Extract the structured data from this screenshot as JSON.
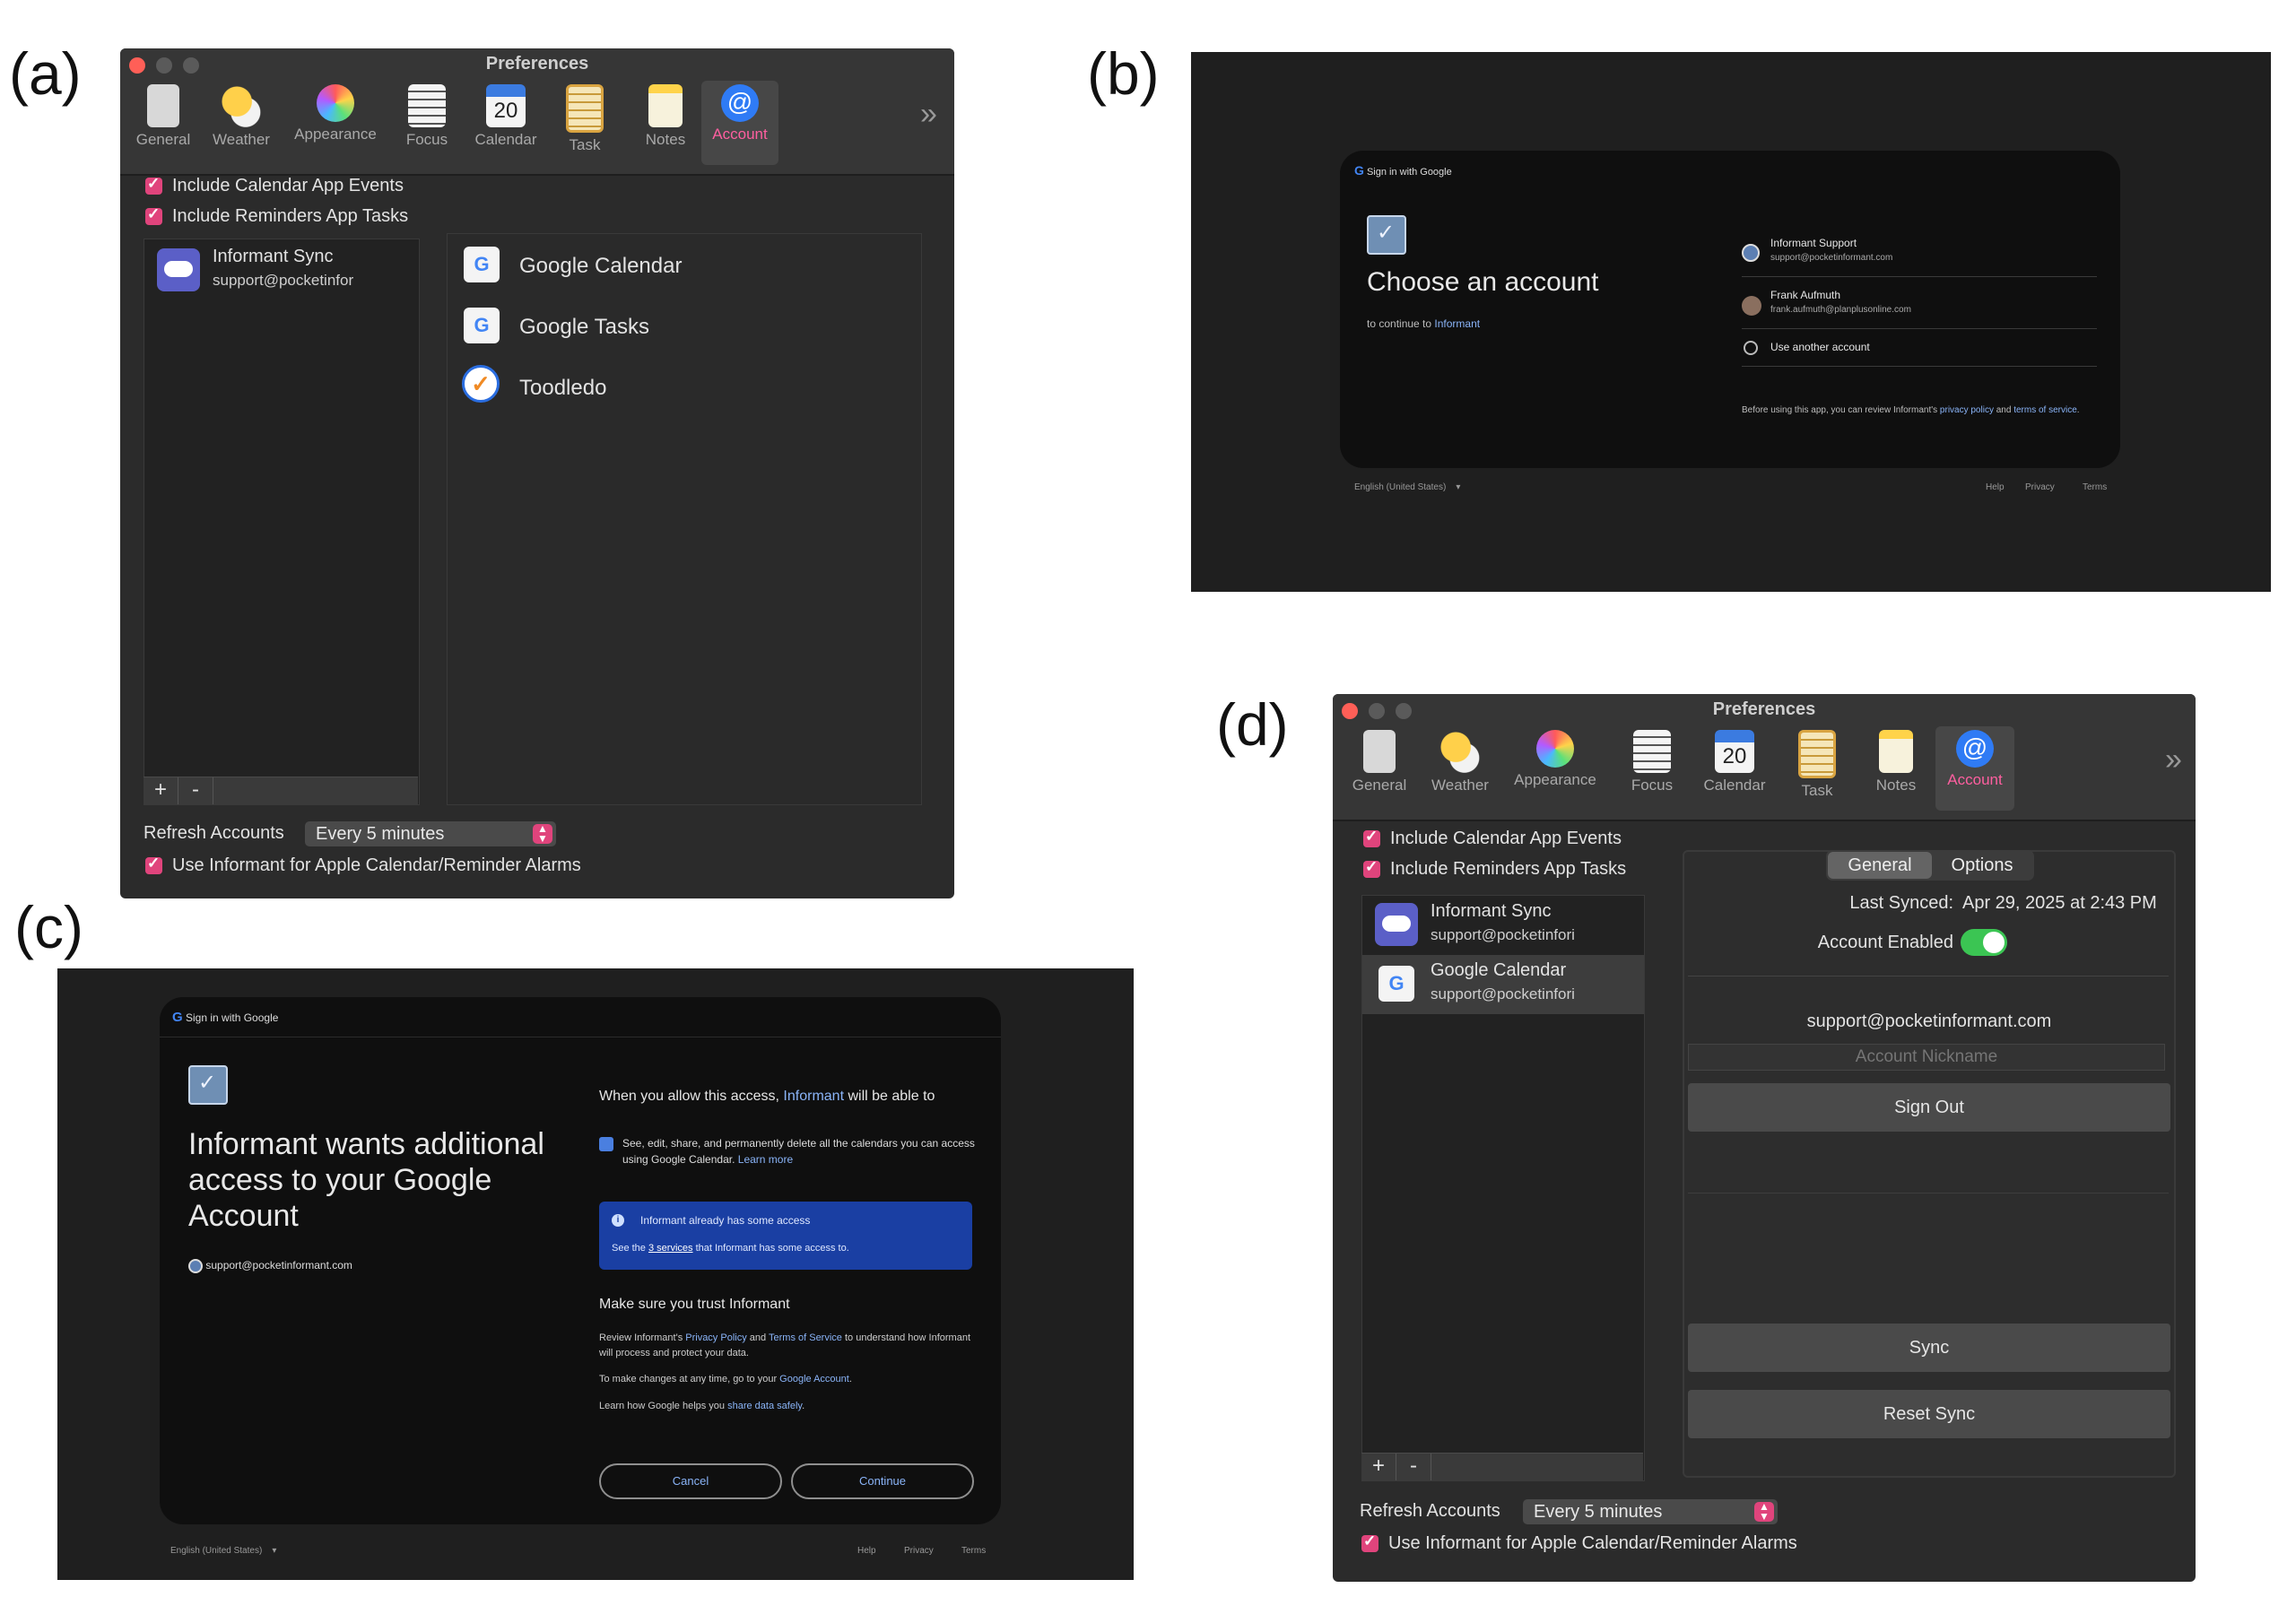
{
  "panel_labels": [
    "(a)",
    "(b)",
    "(c)",
    "(d)"
  ],
  "toolbar": {
    "title": "Preferences",
    "items": [
      {
        "label": "General",
        "icon": "switch-icon"
      },
      {
        "label": "Weather",
        "icon": "weather-icon"
      },
      {
        "label": "Appearance",
        "icon": "color-wheel-icon"
      },
      {
        "label": "Focus",
        "icon": "list-icon"
      },
      {
        "label": "Calendar",
        "icon": "calendar-icon",
        "day": "20"
      },
      {
        "label": "Task",
        "icon": "clipboard-icon"
      },
      {
        "label": "Notes",
        "icon": "notes-icon"
      },
      {
        "label": "Account",
        "icon": "at-icon",
        "glyph": "@"
      }
    ],
    "more": "»"
  },
  "prefs": {
    "include_calendar": "Include Calendar App Events",
    "include_reminders": "Include Reminders App Tasks",
    "refresh_label": "Refresh Accounts",
    "refresh_value": "Every 5 minutes",
    "use_alarms": "Use Informant for Apple Calendar/Reminder Alarms",
    "plus": "+",
    "minus": "-"
  },
  "panel_a": {
    "account_name": "Informant Sync",
    "account_email": "support@pocketinfor",
    "services": [
      "Google Calendar",
      "Google Tasks",
      "Toodledo"
    ],
    "g_glyph": "G"
  },
  "panel_b": {
    "header": "Sign in with Google",
    "heading": "Choose an account",
    "continue_prefix": "to continue to ",
    "continue_app": "Informant",
    "accounts": [
      {
        "name": "Informant Support",
        "email": "support@pocketinformant.com"
      },
      {
        "name": "Frank Aufmuth",
        "email": "frank.aufmuth@planplusonline.com"
      }
    ],
    "use_another": "Use another account",
    "footer_pre": "Before using this app, you can review Informant's ",
    "footer_link1": "privacy policy",
    "footer_mid": " and ",
    "footer_link2": "terms of service",
    "footer_end": ".",
    "language": "English (United States)",
    "links": [
      "Help",
      "Privacy",
      "Terms"
    ]
  },
  "panel_c": {
    "header": "Sign in with Google",
    "heading": "Informant wants additional access to your Google Account",
    "email": "support@pocketinformant.com",
    "allow_pre": "When you allow this access, ",
    "allow_app": "Informant",
    "allow_post": " will be able to",
    "perm_text": "See, edit, share, and permanently delete all the calendars you can access using Google Calendar. ",
    "perm_link": "Learn more",
    "info_title": "Informant already has some access",
    "info_pre": "See the ",
    "info_link": "3 services",
    "info_post": " that Informant has some access to.",
    "trust_heading": "Make sure you trust Informant",
    "trust_pre": "Review Informant's ",
    "trust_link1": "Privacy Policy",
    "trust_and": " and ",
    "trust_link2": "Terms of Service",
    "trust_post": " to understand how Informant will process and protect your data.",
    "changes_pre": "To make changes at any time, go to your ",
    "changes_link": "Google Account",
    "changes_post": ".",
    "learn_pre": "Learn how Google helps you ",
    "learn_link": "share data safely",
    "learn_post": ".",
    "cancel": "Cancel",
    "continue": "Continue",
    "language": "English (United States)",
    "links": [
      "Help",
      "Privacy",
      "Terms"
    ]
  },
  "panel_d": {
    "accounts": [
      {
        "name": "Informant Sync",
        "email": "support@pocketinfori"
      },
      {
        "name": "Google Calendar",
        "email": "support@pocketinfori"
      }
    ],
    "tabs": [
      "General",
      "Options"
    ],
    "last_synced_label": "Last Synced:",
    "last_synced_value": "Apr 29, 2025 at 2:43 PM",
    "enabled_label": "Account Enabled",
    "email": "support@pocketinformant.com",
    "nickname_placeholder": "Account Nickname",
    "sign_out": "Sign Out",
    "sync": "Sync",
    "reset_sync": "Reset Sync"
  },
  "colors": {
    "accent": "#e0447c",
    "link": "#8ab4f8",
    "toggle_on": "#3bc553",
    "info_box": "#1a3fa3"
  }
}
